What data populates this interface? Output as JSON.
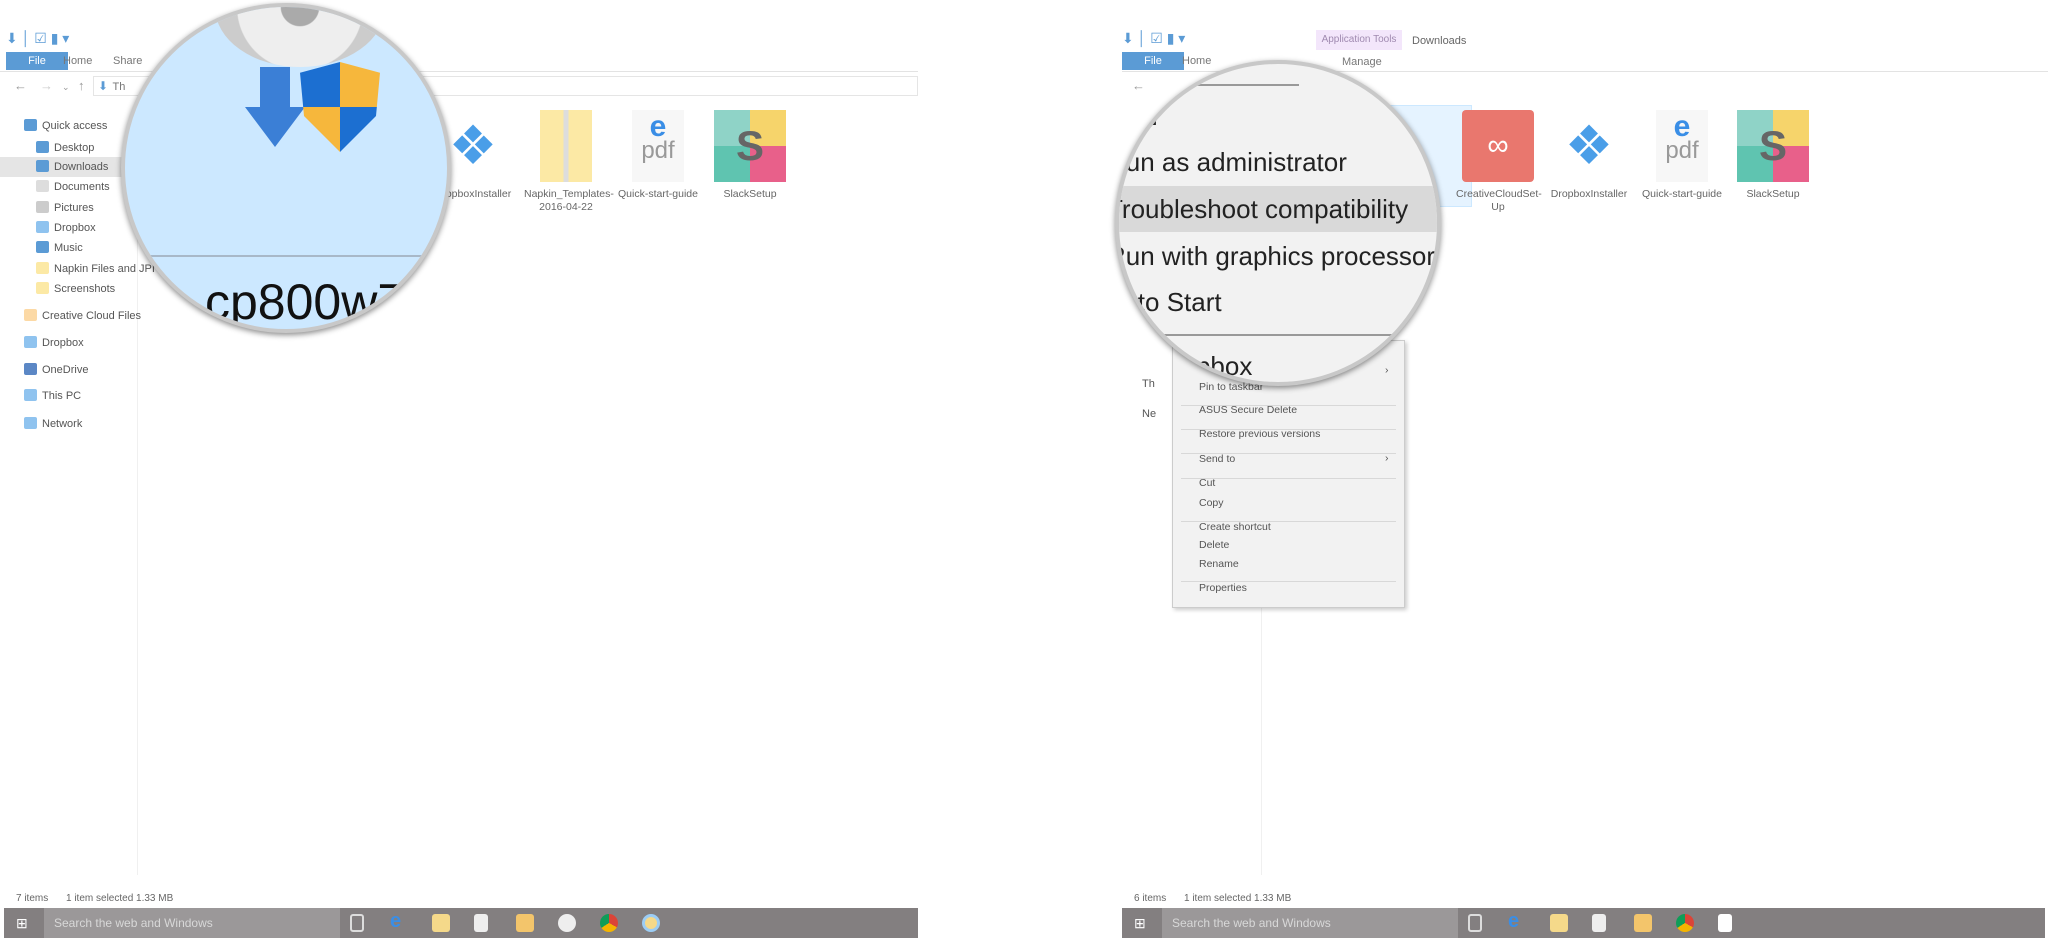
{
  "left": {
    "ribbon_tabs": [
      "File",
      "Home",
      "Share"
    ],
    "address": "Th",
    "sidebar": [
      {
        "label": "Quick access",
        "icon": "star-icon",
        "color": "#5b9bd5"
      },
      {
        "label": "Desktop",
        "icon": "desktop-icon",
        "color": "#5b9bd5"
      },
      {
        "label": "Downloads",
        "icon": "download-icon",
        "color": "#5b9bd5",
        "selected": true
      },
      {
        "label": "Documents",
        "icon": "document-icon",
        "color": "#ddd"
      },
      {
        "label": "Pictures",
        "icon": "pictures-icon",
        "color": "#ccc"
      },
      {
        "label": "Dropbox",
        "icon": "dropbox-icon",
        "color": "#8fc3ef"
      },
      {
        "label": "Music",
        "icon": "music-icon",
        "color": "#5b9bd5"
      },
      {
        "label": "Napkin Files and JPI",
        "icon": "folder-icon",
        "color": "#fce9a5"
      },
      {
        "label": "Screenshots",
        "icon": "folder-icon",
        "color": "#fce9a5"
      },
      {
        "label": "Creative Cloud Files",
        "icon": "creative-cloud-icon",
        "color": "#fcd9a5"
      },
      {
        "label": "Dropbox",
        "icon": "dropbox-icon",
        "color": "#8fc3ef"
      },
      {
        "label": "OneDrive",
        "icon": "onedrive-icon",
        "color": "#5b87c5"
      },
      {
        "label": "This PC",
        "icon": "computer-icon",
        "color": "#8fc3ef"
      },
      {
        "label": "Network",
        "icon": "network-icon",
        "color": "#8fc3ef"
      }
    ],
    "files": [
      {
        "label": "DropboxInstaller",
        "icon": "dropbox-icon"
      },
      {
        "label": "Napkin_Templates-2016-04-22",
        "icon": "zip-folder-icon"
      },
      {
        "label": "Quick-start-guide",
        "icon": "pdf-icon"
      },
      {
        "label": "SlackSetup",
        "icon": "slack-icon"
      }
    ],
    "magnifier_label": "cp800w7",
    "status": {
      "count": "7 items",
      "selected": "1 item selected  1.33 MB"
    },
    "taskbar_search": "Search the web and Windows"
  },
  "right": {
    "ribbon_tabs": [
      "File",
      "Home"
    ],
    "context_tab": {
      "group": "Application Tools",
      "tab": "Manage",
      "title": "Downloads"
    },
    "files": [
      {
        "label": "CreativeCloudSet-Up",
        "icon": "creative-cloud-installer-icon"
      },
      {
        "label": "DropboxInstaller",
        "icon": "dropbox-icon"
      },
      {
        "label": "Quick-start-guide",
        "icon": "pdf-icon"
      },
      {
        "label": "SlackSetup",
        "icon": "slack-icon"
      }
    ],
    "magnified_menu": [
      "Open",
      "Run as administrator",
      "Troubleshoot compatibility",
      "Run with graphics processor",
      "Pin to Start",
      "Share with Dropbox"
    ],
    "context_menu": [
      "Pin to taskbar",
      "ASUS Secure Delete",
      "Restore previous versions",
      "Send to",
      "Cut",
      "Copy",
      "Create shortcut",
      "Delete",
      "Rename",
      "Properties"
    ],
    "sidebar_partial": [
      "Th",
      "Ne"
    ],
    "status": {
      "count": "6 items",
      "selected": "1 item selected  1.33 MB"
    },
    "taskbar_search": "Search the web and Windows"
  },
  "colors": {
    "accent": "#5b9bd5",
    "selection": "#cce8ff",
    "taskbar": "#837f80",
    "context_tab": "#f3e6fb"
  }
}
